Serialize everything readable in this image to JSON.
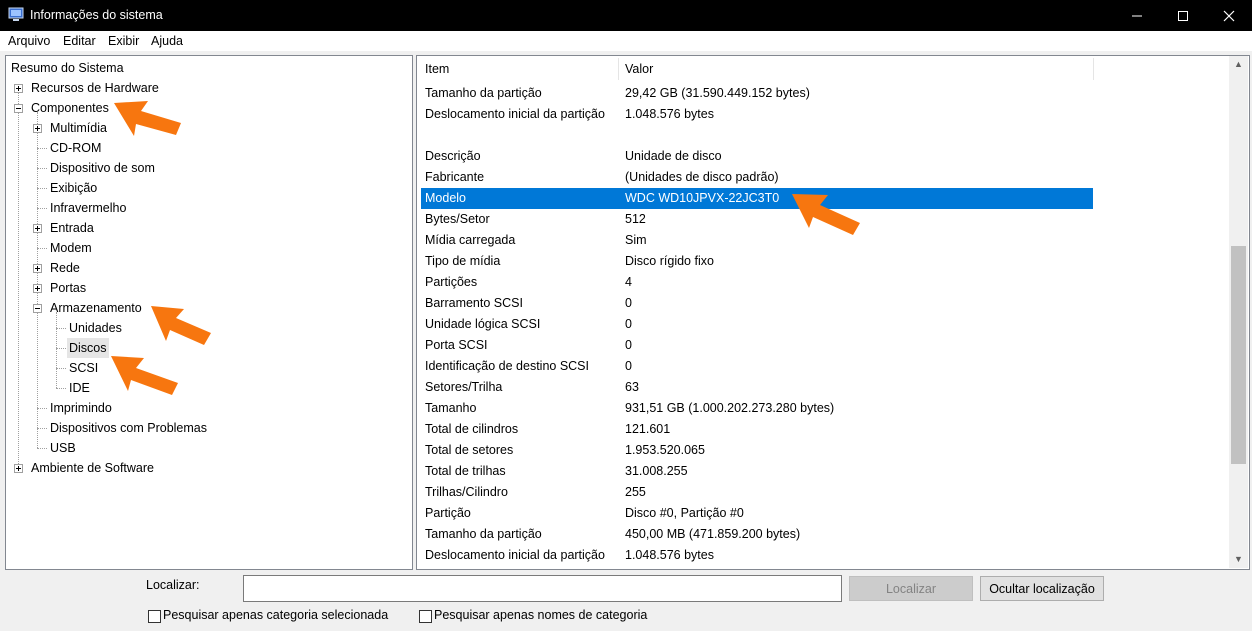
{
  "window": {
    "title": "Informações do sistema",
    "app_icon": "system-info-icon",
    "controls": {
      "minimize": "minimize-icon",
      "maximize": "maximize-icon",
      "close": "close-icon"
    }
  },
  "menu": [
    "Arquivo",
    "Editar",
    "Exibir",
    "Ajuda"
  ],
  "tree": {
    "items": [
      "Resumo do Sistema",
      "Recursos de Hardware",
      "Componentes",
      "Multimídia",
      "CD-ROM",
      "Dispositivo de som",
      "Exibição",
      "Infravermelho",
      "Entrada",
      "Modem",
      "Rede",
      "Portas",
      "Armazenamento",
      "Unidades",
      "Discos",
      "SCSI",
      "IDE",
      "Imprimindo",
      "Dispositivos com Problemas",
      "USB",
      "Ambiente de Software"
    ],
    "selected": "Discos"
  },
  "list": {
    "columns": [
      "Item",
      "Valor"
    ],
    "rows": [
      [
        "Tamanho da partição",
        "29,42 GB (31.590.449.152 bytes)"
      ],
      [
        "Deslocamento inicial da partição",
        "1.048.576 bytes"
      ],
      [
        "",
        ""
      ],
      [
        "Descrição",
        "Unidade de disco"
      ],
      [
        "Fabricante",
        "(Unidades de disco padrão)"
      ],
      [
        "Modelo",
        "WDC WD10JPVX-22JC3T0"
      ],
      [
        "Bytes/Setor",
        "512"
      ],
      [
        "Mídia carregada",
        "Sim"
      ],
      [
        "Tipo de mídia",
        "Disco rígido fixo"
      ],
      [
        "Partições",
        "4"
      ],
      [
        "Barramento SCSI",
        "0"
      ],
      [
        "Unidade lógica SCSI",
        "0"
      ],
      [
        "Porta SCSI",
        "0"
      ],
      [
        "Identificação de destino SCSI",
        "0"
      ],
      [
        "Setores/Trilha",
        "63"
      ],
      [
        "Tamanho",
        "931,51 GB (1.000.202.273.280 bytes)"
      ],
      [
        "Total de cilindros",
        "121.601"
      ],
      [
        "Total de setores",
        "1.953.520.065"
      ],
      [
        "Total de trilhas",
        "31.008.255"
      ],
      [
        "Trilhas/Cilindro",
        "255"
      ],
      [
        "Partição",
        "Disco #0, Partição #0"
      ],
      [
        "Tamanho da partição",
        "450,00 MB (471.859.200 bytes)"
      ],
      [
        "Deslocamento inicial da partição",
        "1.048.576 bytes"
      ]
    ],
    "selected_row": "Modelo"
  },
  "search": {
    "label": "Localizar:",
    "value": "",
    "find_button": "Localizar",
    "hide_button": "Ocultar localização",
    "option_selected_category": "Pesquisar apenas categoria selecionada",
    "option_category_names": "Pesquisar apenas nomes de categoria"
  },
  "colors": {
    "selection": "#0078d7",
    "annotation_arrow": "#f7760f",
    "titlebar": "#000000"
  }
}
